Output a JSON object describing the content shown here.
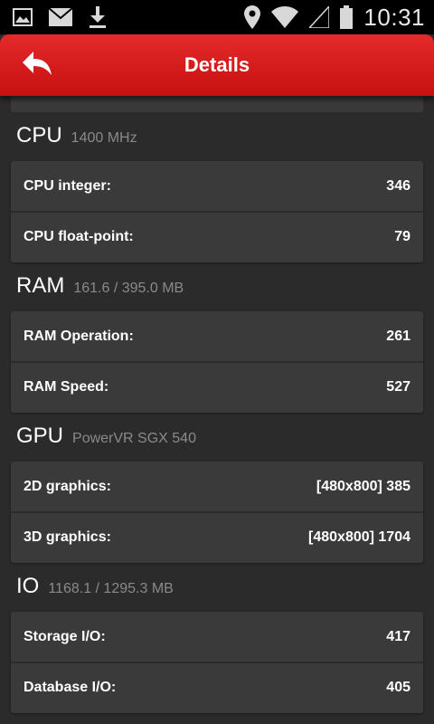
{
  "status_bar": {
    "time": "10:31",
    "icons": [
      "image-icon",
      "email-icon",
      "download-icon",
      "location-icon",
      "wifi-icon",
      "signal-icon",
      "battery-icon"
    ]
  },
  "header": {
    "title": "Details",
    "back_icon": "back-arrow-icon",
    "color": "#d41a1a"
  },
  "sections": [
    {
      "title": "CPU",
      "subtitle": "1400 MHz",
      "rows": [
        {
          "label": "CPU integer:",
          "value": "346"
        },
        {
          "label": "CPU float-point:",
          "value": "79"
        }
      ]
    },
    {
      "title": "RAM",
      "subtitle": "161.6 / 395.0 MB",
      "rows": [
        {
          "label": "RAM Operation:",
          "value": "261"
        },
        {
          "label": "RAM Speed:",
          "value": "527"
        }
      ]
    },
    {
      "title": "GPU",
      "subtitle": "PowerVR SGX 540",
      "rows": [
        {
          "label": "2D graphics:",
          "value": "[480x800] 385"
        },
        {
          "label": "3D graphics:",
          "value": "[480x800] 1704"
        }
      ]
    },
    {
      "title": "IO",
      "subtitle": "1168.1 / 1295.3 MB",
      "rows": [
        {
          "label": "Storage I/O:",
          "value": "417"
        },
        {
          "label": "Database I/O:",
          "value": "405"
        }
      ]
    }
  ]
}
